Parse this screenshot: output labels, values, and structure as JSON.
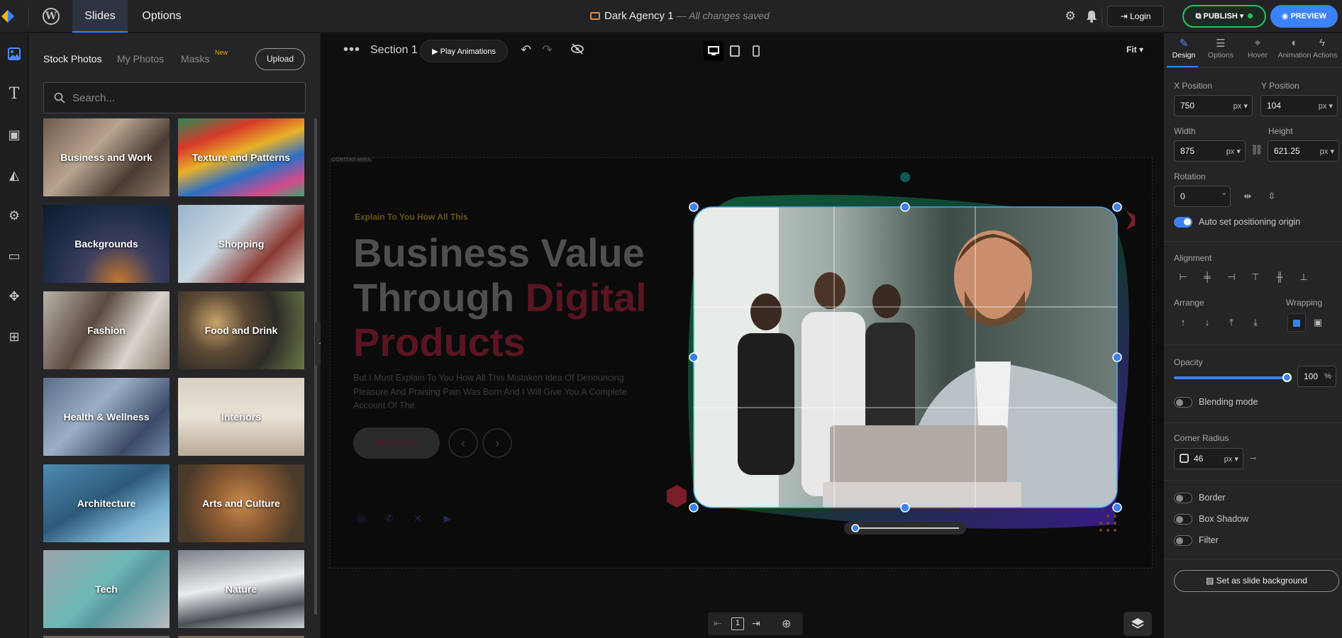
{
  "topbar": {
    "tabs": [
      "Slides",
      "Options"
    ],
    "doc_title": "Dark Agency 1",
    "doc_status": "— All changes saved",
    "login_label": "Login",
    "publish_label": "PUBLISH",
    "preview_label": "PREVIEW"
  },
  "left_panel": {
    "tabs": [
      "Stock Photos",
      "My Photos",
      "Masks"
    ],
    "new_badge": "New",
    "upload_label": "Upload",
    "search_placeholder": "Search...",
    "categories": [
      "Business and Work",
      "Texture and Patterns",
      "Backgrounds",
      "Shopping",
      "Fashion",
      "Food and Drink",
      "Health & Wellness",
      "Interiors",
      "Architecture",
      "Arts and Culture",
      "Tech",
      "Nature"
    ]
  },
  "canvas": {
    "section_label": "Section 1",
    "play_label": "Play Animations",
    "fit_label": "Fit",
    "content_area_tag": "CONTENT AREA",
    "slide": {
      "eyebrow": "Explain To You How All This",
      "headline_1": "Business Value",
      "headline_2": "Through",
      "headline_accent": "Digital",
      "headline_3": "Products",
      "paragraph": "But I Must Explain To You How All This Mistaken Idea Of Denouncing Pleasure And Praising Pain Was Born And I Will Give You A Complete Account Of The.",
      "cta": "Show More"
    },
    "page_number": "1"
  },
  "right_panel": {
    "tabs": [
      "Design",
      "Options",
      "Hover",
      "Animation",
      "Actions"
    ],
    "x_label": "X Position",
    "x_value": "750",
    "y_label": "Y Position",
    "y_value": "104",
    "w_label": "Width",
    "w_value": "875",
    "h_label": "Height",
    "h_value": "621.25",
    "unit": "px",
    "rotation_label": "Rotation",
    "rotation_value": "0",
    "rotation_unit": "°",
    "auto_origin_label": "Auto set positioning origin",
    "alignment_label": "Alignment",
    "arrange_label": "Arrange",
    "wrapping_label": "Wrapping",
    "opacity_label": "Opacity",
    "opacity_value": "100",
    "opacity_unit": "%",
    "blending_label": "Blending mode",
    "corner_label": "Corner Radius",
    "corner_value": "46",
    "border_label": "Border",
    "shadow_label": "Box Shadow",
    "filter_label": "Filter",
    "set_bg_label": "Set as slide background"
  },
  "colors": {
    "accent": "#3b82f6",
    "publish": "#22c55e",
    "new_badge": "#f59e0b"
  }
}
